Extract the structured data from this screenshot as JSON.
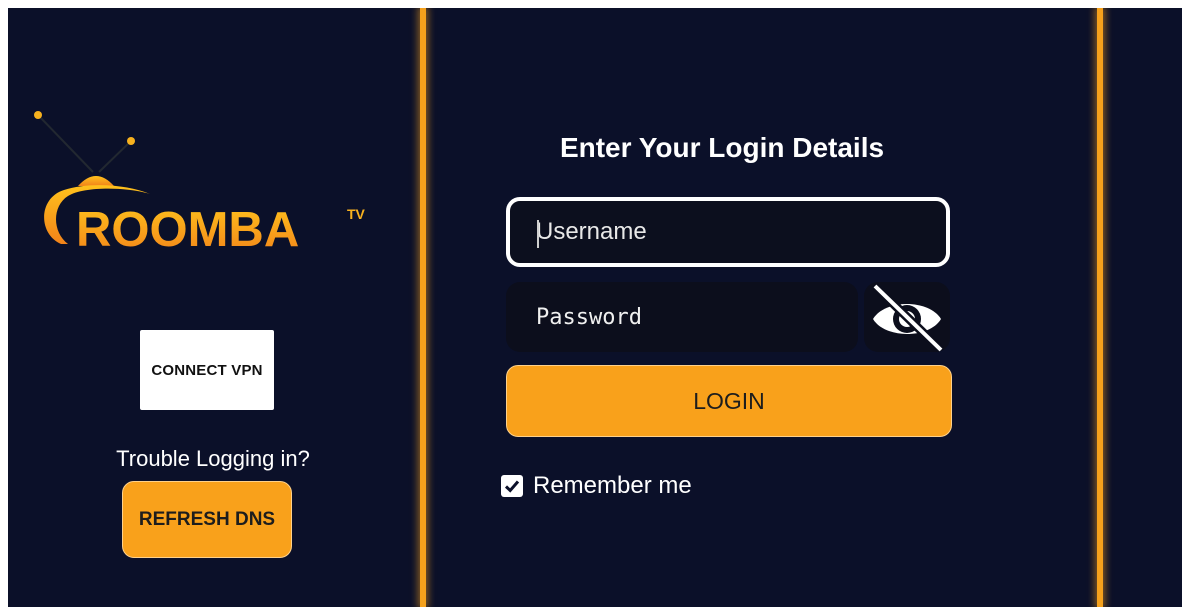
{
  "brand": {
    "logo_text": "ROOMBA",
    "logo_superscript": "TV"
  },
  "left_panel": {
    "vpn_button_label": "CONNECT VPN",
    "trouble_text": "Trouble Logging in?",
    "refresh_dns_label": "REFRESH DNS"
  },
  "login_form": {
    "title": "Enter Your Login Details",
    "username_placeholder": "Username",
    "password_placeholder": "Password",
    "password_visibility_icon": "eye-off-icon",
    "login_button_label": "LOGIN",
    "remember_me_label": "Remember me",
    "remember_me_checked": true
  },
  "colors": {
    "background": "#0b1029",
    "accent": "#f9a11b",
    "divider": "#f5a11c",
    "text": "#ffffff"
  }
}
